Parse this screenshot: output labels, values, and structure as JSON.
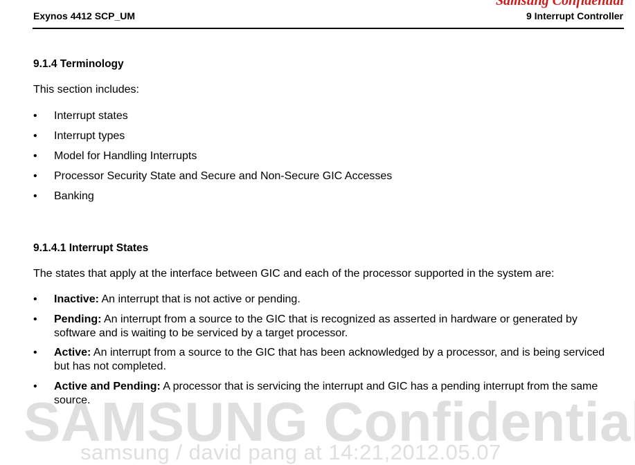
{
  "header": {
    "confidential_mark": "Samsung Confidential",
    "doc_title": "Exynos 4412 SCP_UM",
    "chapter": "9 Interrupt Controller"
  },
  "section_terminology": {
    "heading": "9.1.4 Terminology",
    "intro": "This section includes:",
    "items": [
      "Interrupt states",
      "Interrupt types",
      "Model for Handling Interrupts",
      "Processor Security State and Secure and Non-Secure GIC Accesses",
      "Banking"
    ]
  },
  "section_states": {
    "heading": "9.1.4.1 Interrupt States",
    "intro": "The states that apply at the interface between GIC and each of the processor supported in the system are:",
    "items": [
      {
        "term": "Inactive:",
        "text": " An interrupt that is not active or pending."
      },
      {
        "term": "Pending:",
        "text": " An interrupt from a source to the GIC that is recognized as asserted in hardware or generated by software and is waiting to be serviced by a target processor."
      },
      {
        "term": "Active:",
        "text": " An interrupt from a source to the GIC that has been acknowledged by a processor, and is being serviced but has not completed."
      },
      {
        "term": "Active and Pending:",
        "text": " A processor that is servicing the interrupt and GIC has a pending interrupt from the same source."
      }
    ]
  },
  "watermark": {
    "main": "SAMSUNG Confidential",
    "sub": "samsung / david pang at 14:21,2012.05.07"
  }
}
